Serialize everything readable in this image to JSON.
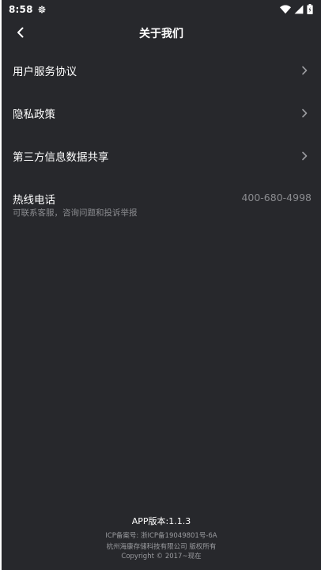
{
  "status_bar": {
    "time": "8:58",
    "icons": [
      "gear-icon",
      "wifi-icon",
      "cellular-signal-icon",
      "battery-icon"
    ]
  },
  "nav": {
    "title": "关于我们",
    "back_icon": "chevron-left-icon"
  },
  "menu": {
    "items": [
      {
        "label": "用户服务协议",
        "icon": "chevron-right-icon"
      },
      {
        "label": "隐私政策",
        "icon": "chevron-right-icon"
      },
      {
        "label": "第三方信息数据共享",
        "icon": "chevron-right-icon"
      }
    ]
  },
  "hotline": {
    "title": "热线电话",
    "subtitle": "可联系客服，咨询问题和投诉举报",
    "number": "400-680-4998"
  },
  "footer": {
    "version": "APP版本:1.1.3",
    "icp": "ICP备案号: 浙ICP备19049801号-6A",
    "company": "杭州海康存储科技有限公司 版权所有",
    "copyright": "Copyright © 2017~现在"
  },
  "colors": {
    "background": "#27282c",
    "primary_text": "#ffffff",
    "secondary_text": "#8a8b8f",
    "chevron": "#9a9b9f"
  }
}
